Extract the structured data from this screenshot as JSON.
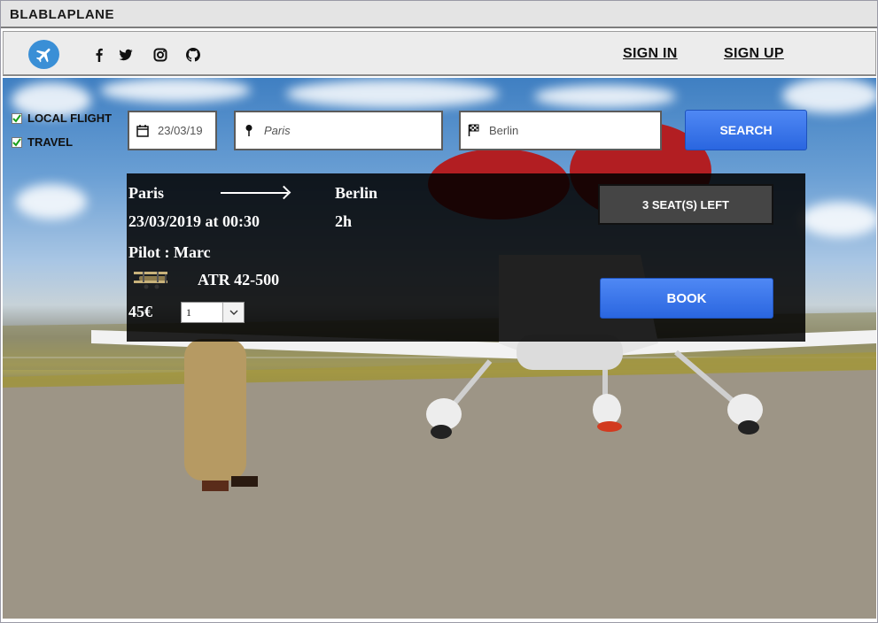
{
  "window": {
    "title": "BLABLAPLANE"
  },
  "navbar": {
    "logo_icon": "airplane-logo-icon",
    "social": [
      {
        "name": "facebook-icon"
      },
      {
        "name": "twitter-icon"
      },
      {
        "name": "instagram-icon"
      },
      {
        "name": "github-icon"
      }
    ],
    "sign_in": "SIGN IN",
    "sign_up": "SIGN UP"
  },
  "filters": {
    "local_flight": {
      "label": "LOCAL FLIGHT",
      "checked": true
    },
    "travel": {
      "label": "TRAVEL",
      "checked": true
    }
  },
  "search": {
    "date": "23/03/19",
    "from": "Paris",
    "to": "Berlin",
    "button": "SEARCH"
  },
  "result": {
    "from": "Paris",
    "to": "Berlin",
    "datetime": "23/03/2019 at 00:30",
    "duration": "2h",
    "pilot": "Pilot : Marc",
    "aircraft": "ATR 42-500",
    "price": "45€",
    "seats_selected": "1",
    "seats_left": "3 SEAT(S) LEFT",
    "book": "BOOK"
  },
  "colors": {
    "accent": "#2a66e0",
    "panel": "#000000"
  }
}
